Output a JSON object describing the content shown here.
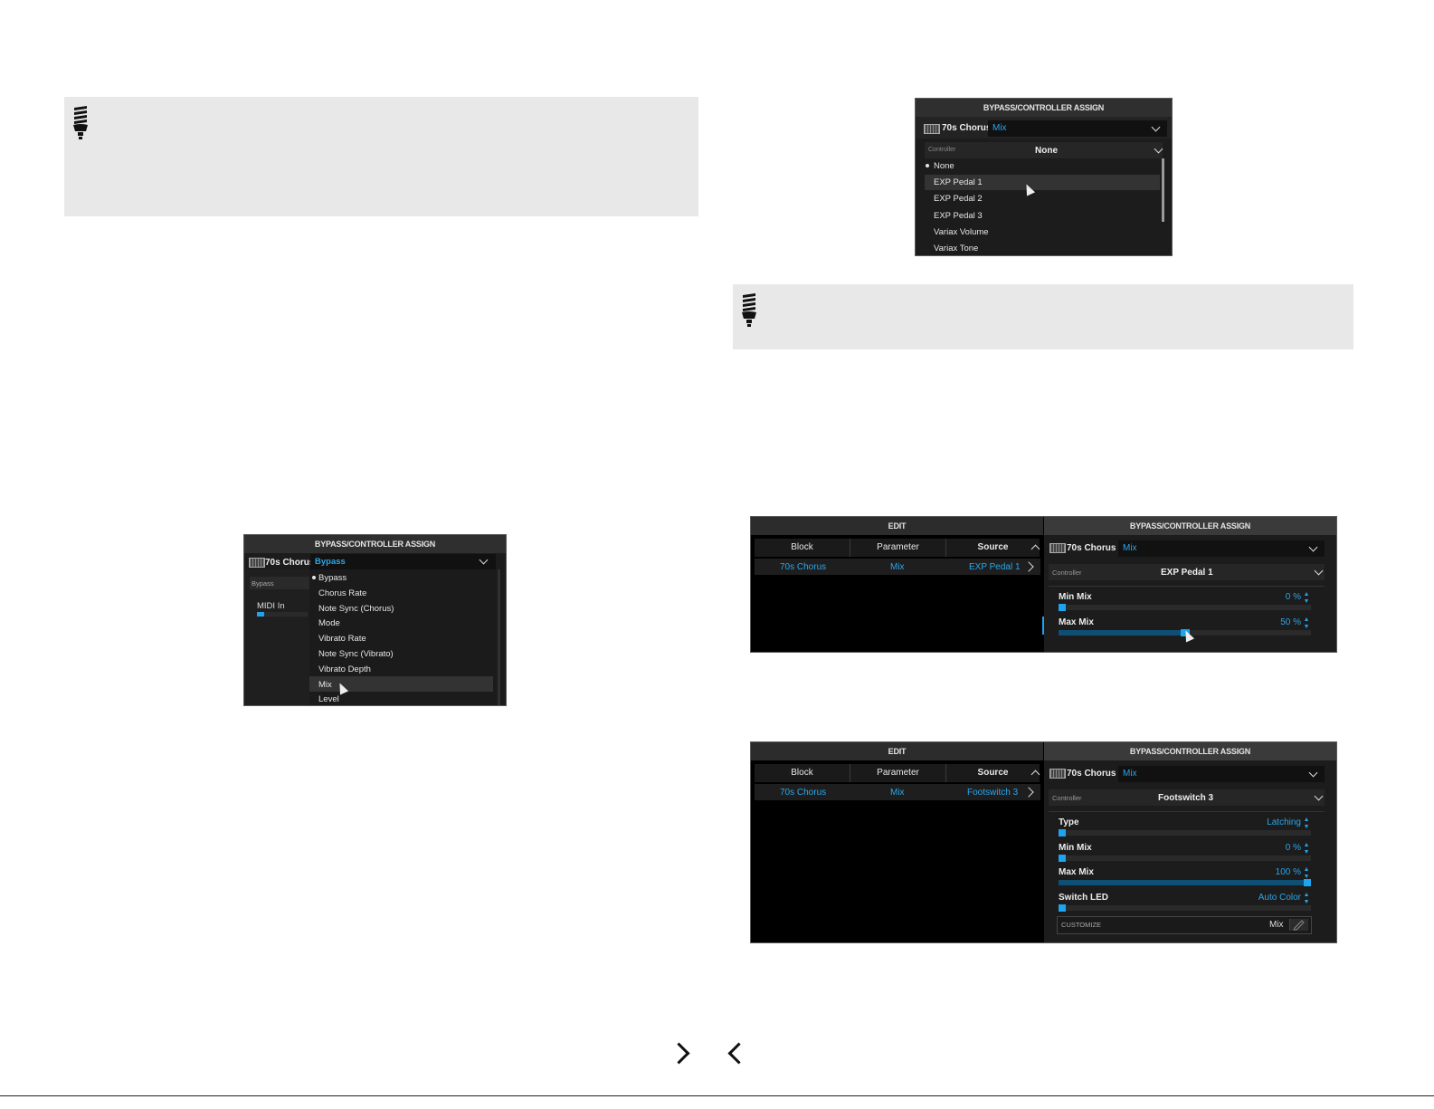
{
  "fig_bypass": {
    "header": "BYPASS/CONTROLLER ASSIGN",
    "block_name": "70s Chorus",
    "selected_param": "Bypass",
    "left_label": "Bypass",
    "left_value": "MIDI In",
    "items": [
      "Bypass",
      "Chorus Rate",
      "Note Sync (Chorus)",
      "Mode",
      "Vibrato Rate",
      "Note Sync (Vibrato)",
      "Vibrato Depth",
      "Mix",
      "Level"
    ]
  },
  "fig_controller": {
    "header": "BYPASS/CONTROLLER ASSIGN",
    "block_name": "70s Chorus",
    "selected_param": "Mix",
    "controller_label": "Controller",
    "controller_value": "None",
    "items": [
      "None",
      "EXP Pedal 1",
      "EXP Pedal 2",
      "EXP Pedal 3",
      "Variax Volume",
      "Variax Tone"
    ]
  },
  "fig_exp": {
    "edit_header": "EDIT",
    "assign_header": "BYPASS/CONTROLLER ASSIGN",
    "columns": [
      "Block",
      "Parameter",
      "Source"
    ],
    "row": {
      "block": "70s Chorus",
      "parameter": "Mix",
      "source": "EXP Pedal 1"
    },
    "block_name": "70s Chorus",
    "selected_param": "Mix",
    "controller_label": "Controller",
    "controller_value": "EXP Pedal 1",
    "params": [
      {
        "label": "Min Mix",
        "value": "0 %",
        "level": 0
      },
      {
        "label": "Max Mix",
        "value": "50 %",
        "level": 0.5
      }
    ]
  },
  "fig_fs": {
    "edit_header": "EDIT",
    "assign_header": "BYPASS/CONTROLLER ASSIGN",
    "columns": [
      "Block",
      "Parameter",
      "Source"
    ],
    "row": {
      "block": "70s Chorus",
      "parameter": "Mix",
      "source": "Footswitch 3"
    },
    "block_name": "70s Chorus",
    "selected_param": "Mix",
    "controller_label": "Controller",
    "controller_value": "Footswitch 3",
    "params": [
      {
        "label": "Type",
        "value": "Latching",
        "level": 0
      },
      {
        "label": "Min Mix",
        "value": "0 %",
        "level": 0
      },
      {
        "label": "Max Mix",
        "value": "100 %",
        "level": 1
      },
      {
        "label": "Switch LED",
        "value": "Auto Color",
        "level": 0
      }
    ],
    "customize_label": "CUSTOMIZE",
    "customize_value": "Mix"
  },
  "icons": [
    "lightbulb-icon",
    "chevron-right-icon",
    "chevron-left-icon"
  ]
}
